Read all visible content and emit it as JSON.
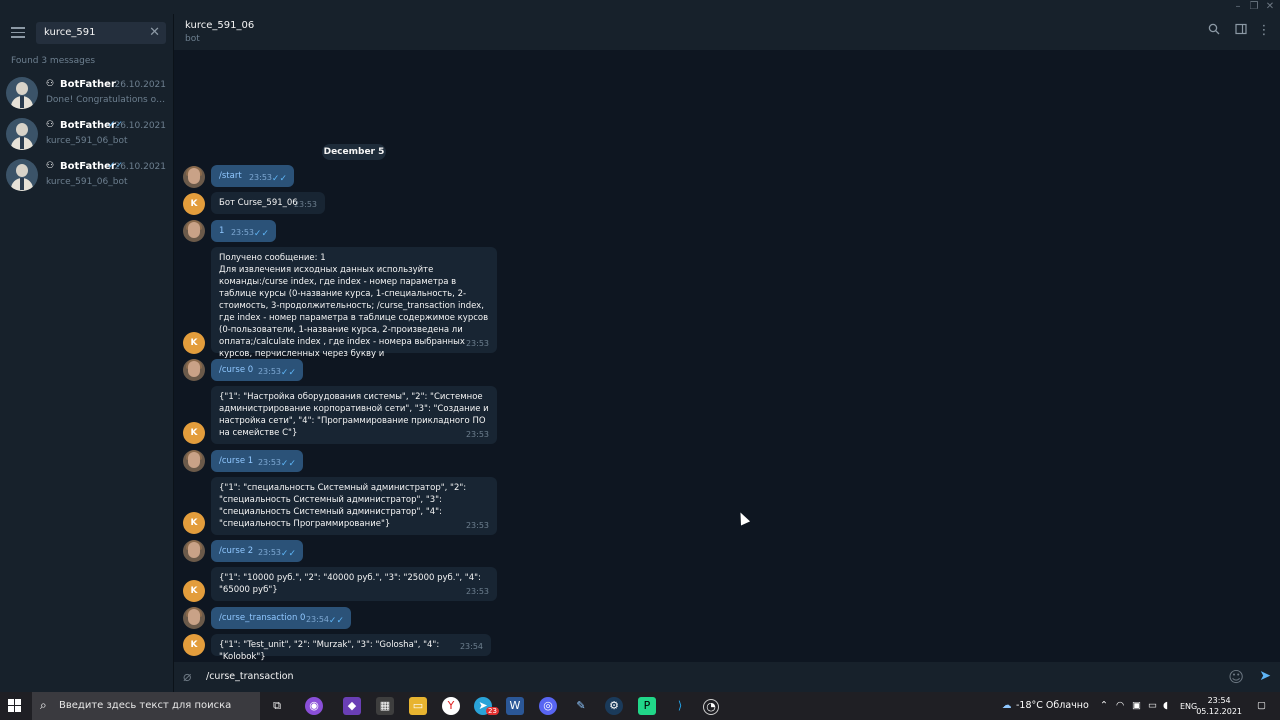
{
  "window": {
    "minimize": "–",
    "maximize": "❐",
    "close": "✕"
  },
  "sidebar": {
    "search_value": "kurce_591",
    "clear_icon": "✕",
    "found_label": "Found 3 messages",
    "results": [
      {
        "name": "BotFather",
        "date": "26.10.2021",
        "checks": "",
        "preview": "Done! Congratulations on yo..."
      },
      {
        "name": "BotFather",
        "date": "26.10.2021",
        "checks": "✓✓",
        "preview": "kurce_591_06_bot"
      },
      {
        "name": "BotFather",
        "date": "26.10.2021",
        "checks": "✓✓",
        "preview": "kurce_591_06_bot"
      }
    ]
  },
  "header": {
    "title": "kurce_591_06",
    "subtitle": "bot"
  },
  "chat": {
    "date_pill": "December 5",
    "bot_initial": "K",
    "messages": [
      {
        "dir": "out",
        "text": "/start",
        "time": "23:53"
      },
      {
        "dir": "in",
        "text": "Бот Curse_591_06",
        "time": "23:53"
      },
      {
        "dir": "out",
        "text": "1",
        "time": "23:53"
      },
      {
        "dir": "in",
        "text": "Получено сообщение: 1\nДля извлечения исходных данных используйте команды:/curse index, где index - номер параметра в таблице курсы (0-название курса, 1-специальность, 2-стоимость, 3-продолжительность; /curse_transaction index, где index - номер параметра в таблице содержимое курсов (0-пользователи, 1-название курса, 2-произведена ли оплата;/calculate index , где index - номера выбранных курсов, перчисленных через букву и",
        "time": "23:53"
      },
      {
        "dir": "out",
        "text": "/curse 0",
        "time": "23:53"
      },
      {
        "dir": "in",
        "text": "{\"1\": \"Настройка оборудования системы\", \"2\": \"Системное администрирование корпоративной сети\", \"3\": \"Создание и настройка сети\", \"4\": \"Программирование прикладного ПО на семействе С\"}",
        "time": "23:53"
      },
      {
        "dir": "out",
        "text": "/curse 1",
        "time": "23:53"
      },
      {
        "dir": "in",
        "text": "{\"1\": \"специальность Системный администратор\", \"2\": \"специальность Системный администратор\", \"3\": \"специальность Системный администратор\", \"4\": \"специальность Программирование\"}",
        "time": "23:53"
      },
      {
        "dir": "out",
        "text": "/curse 2",
        "time": "23:53"
      },
      {
        "dir": "in",
        "text": "{\"1\": \"10000 руб.\", \"2\": \"40000 руб.\", \"3\": \"25000 руб.\", \"4\": \"65000 руб\"}",
        "time": "23:53"
      },
      {
        "dir": "out",
        "text": "/curse_transaction 0",
        "time": "23:54"
      },
      {
        "dir": "in",
        "text": "{\"1\": \"Test_unit\", \"2\": \"Murzak\", \"3\": \"Golosha\", \"4\": \"Kolobok\"}",
        "time": "23:54"
      }
    ]
  },
  "composer": {
    "value": "/curse_transaction"
  },
  "taskbar": {
    "search_placeholder": "Введите здесь текст для поиска",
    "weather": "-18°C  Облачно",
    "lang": "ENG",
    "time": "23:54",
    "date": "05.12.2021",
    "badge": "23"
  }
}
